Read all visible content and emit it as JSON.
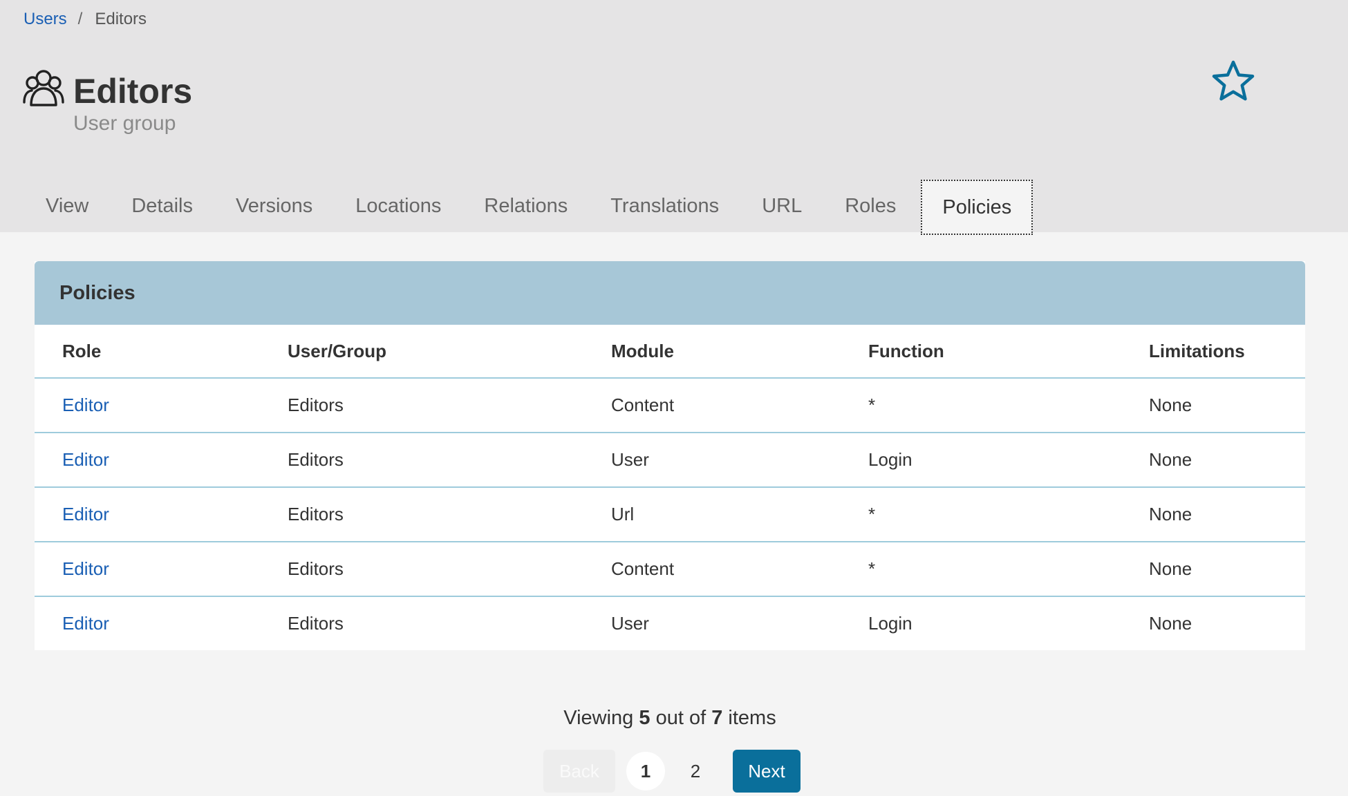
{
  "breadcrumb": {
    "parent": "Users",
    "separator": "/",
    "current": "Editors"
  },
  "header": {
    "icon": "users-icon",
    "title": "Editors",
    "subtitle": "User group",
    "bookmark_icon": "star-outline-icon",
    "accent_color": "#0a6f9b"
  },
  "tabs": [
    {
      "label": "View"
    },
    {
      "label": "Details"
    },
    {
      "label": "Versions"
    },
    {
      "label": "Locations"
    },
    {
      "label": "Relations"
    },
    {
      "label": "Translations"
    },
    {
      "label": "URL"
    },
    {
      "label": "Roles"
    },
    {
      "label": "Policies",
      "active": true
    }
  ],
  "panel": {
    "title": "Policies",
    "columns": [
      "Role",
      "User/Group",
      "Module",
      "Function",
      "Limitations"
    ],
    "rows": [
      {
        "role": "Editor",
        "user_group": "Editors",
        "module": "Content",
        "function": "*",
        "limitations": "None"
      },
      {
        "role": "Editor",
        "user_group": "Editors",
        "module": "User",
        "function": "Login",
        "limitations": "None"
      },
      {
        "role": "Editor",
        "user_group": "Editors",
        "module": "Url",
        "function": "*",
        "limitations": "None"
      },
      {
        "role": "Editor",
        "user_group": "Editors",
        "module": "Content",
        "function": "*",
        "limitations": "None"
      },
      {
        "role": "Editor",
        "user_group": "Editors",
        "module": "User",
        "function": "Login",
        "limitations": "None"
      }
    ]
  },
  "footer": {
    "viewing_prefix": "Viewing",
    "shown": "5",
    "middle": "out of",
    "total": "7",
    "suffix": "items"
  },
  "pagination": {
    "back_label": "Back",
    "pages": [
      "1",
      "2"
    ],
    "current_page": "1",
    "next_label": "Next"
  }
}
